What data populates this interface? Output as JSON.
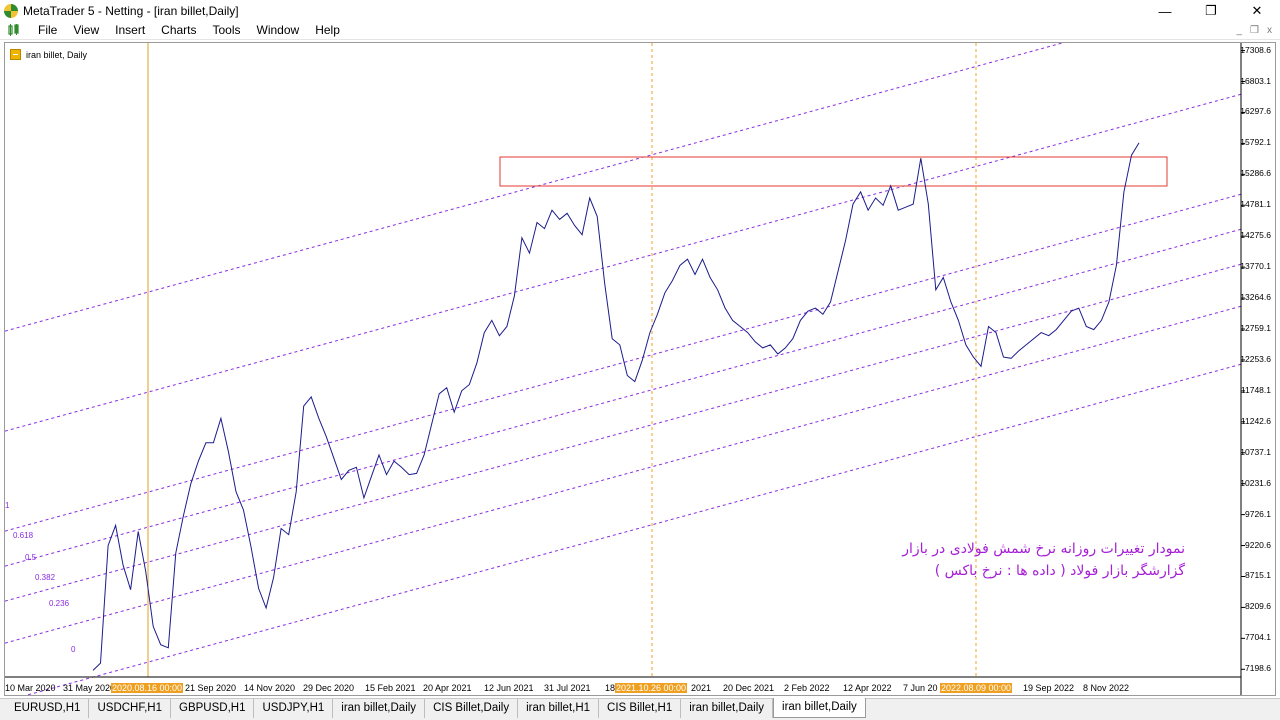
{
  "window": {
    "title": "MetaTrader 5 - Netting - [iran billet,Daily]",
    "minimize": "—",
    "maximize": "❐",
    "close": "✕"
  },
  "menu": {
    "items": [
      "File",
      "View",
      "Insert",
      "Charts",
      "Tools",
      "Window",
      "Help"
    ],
    "mdi_minimize": "_",
    "mdi_restore": "❐",
    "mdi_close": "x"
  },
  "chart": {
    "symbol_label": "iran billet, Daily",
    "price_labels": [
      "17308.6",
      "16803.1",
      "16297.6",
      "15792.1",
      "15286.6",
      "14781.1",
      "14275.6",
      "13770.1",
      "13264.6",
      "12759.1",
      "12253.6",
      "11748.1",
      "11242.6",
      "10737.1",
      "10231.6",
      "9726.1",
      "9220.6",
      "8715.1",
      "8209.6",
      "7704.1",
      "7198.6"
    ],
    "date_labels": [
      {
        "text": "10 Mar 2020",
        "hl": false
      },
      {
        "text": "31 May 2020",
        "hl": false
      },
      {
        "text": "2020.08.16 00:00",
        "hl": true
      },
      {
        "text": "21 Sep 2020",
        "hl": false
      },
      {
        "text": "14 Nov 2020",
        "hl": false
      },
      {
        "text": "29 Dec 2020",
        "hl": false
      },
      {
        "text": "15 Feb 2021",
        "hl": false
      },
      {
        "text": "20 Apr 2021",
        "hl": false
      },
      {
        "text": "12 Jun 2021",
        "hl": false
      },
      {
        "text": "31 Jul 2021",
        "hl": false
      },
      {
        "text": "18",
        "hl": false
      },
      {
        "text": "2021.10.26 00:00",
        "hl": true
      },
      {
        "text": "2021",
        "hl": false
      },
      {
        "text": "20 Dec 2021",
        "hl": false
      },
      {
        "text": "2 Feb 2022",
        "hl": false
      },
      {
        "text": "12 Apr 2022",
        "hl": false
      },
      {
        "text": "7 Jun 20",
        "hl": false
      },
      {
        "text": "2022.08.09 00:00",
        "hl": true
      },
      {
        "text": "19 Sep 2022",
        "hl": false
      },
      {
        "text": "8 Nov 2022",
        "hl": false
      }
    ],
    "fib_labels": [
      "0",
      "0.236",
      "0.382",
      "0.5",
      "0.618",
      "1"
    ],
    "annotation_line1": "نمودار تغییرات روزانه نرخ شمش فولادی در بازار",
    "annotation_line2": "گزارشگر بازار فولاد ( داده ها : نرخ باکس )",
    "colors": {
      "price_line": "#1c1c8c",
      "fib_line": "#8a2be2",
      "vline": "#f0a020",
      "box": "#e53935",
      "annotation": "#a61fd6"
    }
  },
  "tabs": [
    {
      "label": "EURUSD,H1",
      "active": false
    },
    {
      "label": "USDCHF,H1",
      "active": false
    },
    {
      "label": "GBPUSD,H1",
      "active": false
    },
    {
      "label": "USDJPY,H1",
      "active": false
    },
    {
      "label": "iran billet,Daily",
      "active": false
    },
    {
      "label": "CIS Billet,Daily",
      "active": false
    },
    {
      "label": "iran billet,H1",
      "active": false
    },
    {
      "label": "CIS Billet,H1",
      "active": false
    },
    {
      "label": "iran billet,Daily",
      "active": false
    },
    {
      "label": "iran billet,Daily",
      "active": true
    }
  ],
  "chart_data": {
    "type": "line",
    "series": [
      {
        "values": [
          7180,
          7300,
          9220,
          9550,
          8900,
          8500,
          9450,
          8800,
          7900,
          7600,
          7550,
          9100,
          9700,
          10230,
          10600,
          10900,
          10900,
          11300,
          10750,
          10100,
          9800,
          9200,
          8520,
          8200,
          8700,
          9500,
          9400,
          10100,
          11500,
          11650,
          11300,
          11000,
          10650,
          10300,
          10450,
          10500,
          10000,
          10350,
          10700,
          10380,
          10600,
          10500,
          10380,
          10400,
          10700,
          11200,
          11700,
          11800,
          11400,
          11750,
          11850,
          12200,
          12700,
          12900,
          12650,
          12800,
          13300,
          14250,
          14000,
          14500,
          14400,
          14700,
          14550,
          14650,
          14450,
          14300,
          14900,
          14600,
          13500,
          12600,
          12500,
          12000,
          11900,
          12250,
          12700,
          13000,
          13350,
          13550,
          13800,
          13900,
          13650,
          13900,
          13600,
          13400,
          13100,
          12900,
          12800,
          12700,
          12550,
          12450,
          12500,
          12350,
          12450,
          12600,
          12900,
          13050,
          13100,
          13000,
          13200,
          13700,
          14200,
          14800,
          15000,
          14700,
          14900,
          14780,
          15100,
          14700,
          14750,
          14800,
          15550,
          14800,
          13400,
          13600,
          13200,
          12900,
          12500,
          12300,
          12150,
          12800,
          12700,
          12300,
          12280,
          12400,
          12500,
          12600,
          12700,
          12650,
          12750,
          12900,
          13050,
          13100,
          12800,
          12750,
          12900,
          13200,
          13800,
          15000,
          15600,
          15800
        ]
      }
    ],
    "xlim": [
      "10 Mar 2020",
      "2022"
    ],
    "ylim": [
      7040,
      17400
    ],
    "fib_levels": [
      "0",
      "0.236",
      "0.382",
      "0.5",
      "0.618",
      "1"
    ],
    "highlighted_dates": [
      "2020.08.16 00:00",
      "2021.10.26 00:00",
      "2022.08.09 00:00"
    ]
  }
}
